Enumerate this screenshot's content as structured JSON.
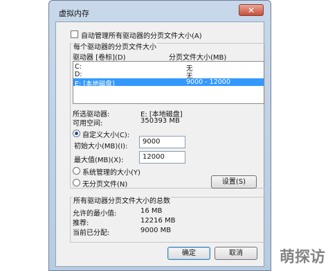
{
  "window": {
    "title": "虚拟内存",
    "close_glyph": "✕"
  },
  "auto_manage": {
    "label": "自动管理所有驱动器的分页文件大小(A)",
    "checked": false
  },
  "per_drive_group": {
    "title": "每个驱动器的分页文件大小"
  },
  "drive_list": {
    "col_drive": "驱动器 [卷标](D)",
    "col_size": "分页文件大小(MB)",
    "rows": [
      {
        "drive": "C:",
        "size": "无"
      },
      {
        "drive": "D:",
        "size": "无"
      },
      {
        "drive": "E:  [本地磁盘]",
        "size": "9000 - 12000",
        "selected": true
      }
    ]
  },
  "selected_drive": {
    "label": "所选驱动器:",
    "value": "E:  [本地磁盘]"
  },
  "free_space": {
    "label": "可用空间:",
    "value": "350393 MB"
  },
  "custom_size": {
    "label": "自定义大小(C):",
    "selected": true
  },
  "initial_size": {
    "label": "初始大小(MB)(I):",
    "value": "9000"
  },
  "max_size": {
    "label": "最大值(MB)(X):",
    "value": "12000"
  },
  "system_managed": {
    "label": "系统管理的大小(Y)",
    "selected": false
  },
  "no_paging": {
    "label": "无分页文件(N)",
    "selected": false
  },
  "set_button": {
    "label": "设置(S)"
  },
  "totals_group": {
    "title": "所有驱动器分页文件大小的总数"
  },
  "min_allowed": {
    "label": "允许的最小值:",
    "value": "16 MB"
  },
  "recommended": {
    "label": "推荐:",
    "value": "12216 MB"
  },
  "currently_allocated": {
    "label": "当前已分配:",
    "value": "9000 MB"
  },
  "ok_button": {
    "label": "确定"
  },
  "cancel_button": {
    "label": "取消"
  },
  "watermark": {
    "text": "萌探访"
  }
}
